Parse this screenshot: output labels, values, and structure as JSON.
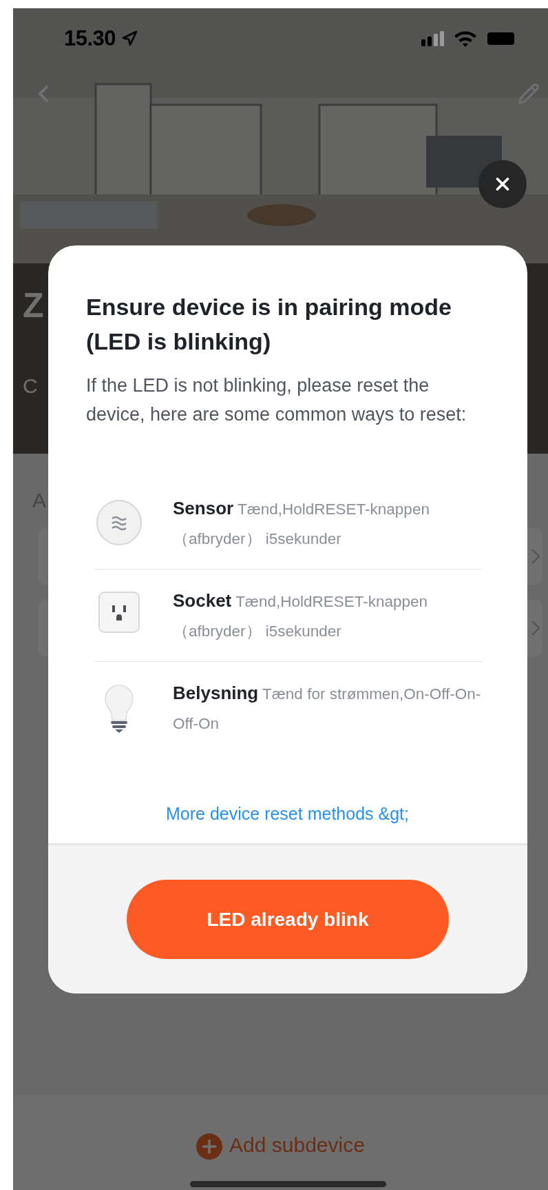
{
  "status_bar": {
    "time": "15.30"
  },
  "header": {
    "title_fragment": "Z",
    "subtitle_fragment": "C"
  },
  "page": {
    "section_fragment": "A",
    "add_subdevice": "Add subdevice"
  },
  "modal": {
    "title": "Ensure device is in pairing mode (LED is blinking)",
    "description": "If the LED is not blinking, please reset the device, here are some common ways to reset:",
    "devices": [
      {
        "kind": "sensor",
        "name": "Sensor",
        "instructions": "Tænd,HoldRESET-knappen （afbryder） i5sekunder"
      },
      {
        "kind": "socket",
        "name": "Socket",
        "instructions": "Tænd,HoldRESET-knappen （afbryder） i5sekunder"
      },
      {
        "kind": "bulb",
        "name": "Belysning",
        "instructions": "Tænd for strømmen,On-Off-On-Off-On"
      }
    ],
    "link": "More device reset methods &gt;",
    "button": "LED already blink"
  }
}
